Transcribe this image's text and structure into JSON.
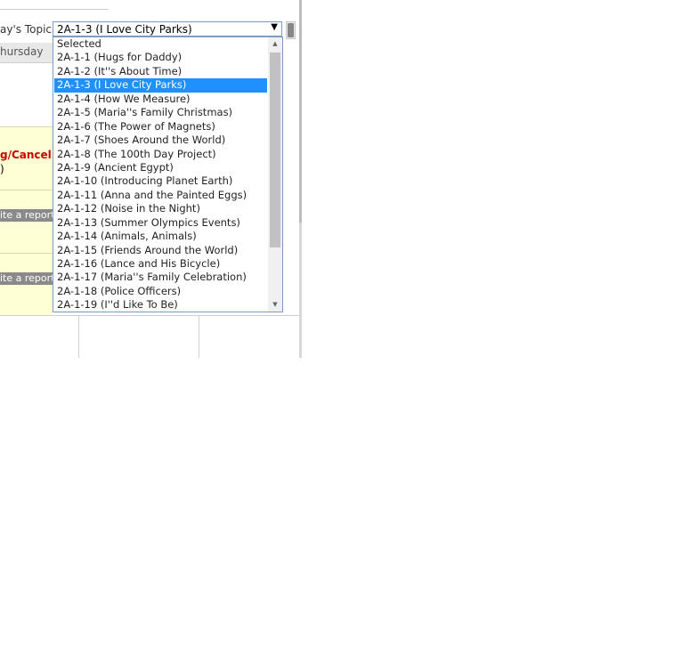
{
  "topic": {
    "label": "ay's Topic",
    "selected_value": "2A-1-3 (I Love City Parks)"
  },
  "day_header": "hursday",
  "cells": {
    "cancel_label": "g/Cancel",
    "paren_label": ")",
    "report_button_1": "ite a report",
    "report_button_2": "ite a report"
  },
  "dropdown": {
    "options": [
      "Selected",
      "2A-1-1 (Hugs for Daddy)",
      "2A-1-2 (It''s About Time)",
      "2A-1-3 (I Love City Parks)",
      "2A-1-4 (How We Measure)",
      "2A-1-5 (Maria''s Family Christmas)",
      "2A-1-6 (The Power of Magnets)",
      "2A-1-7 (Shoes Around the World)",
      "2A-1-8 (The 100th Day Project)",
      "2A-1-9 (Ancient Egypt)",
      "2A-1-10 (Introducing Planet Earth)",
      "2A-1-11 (Anna and the Painted Eggs)",
      "2A-1-12 (Noise in the Night)",
      "2A-1-13 (Summer Olympics Events)",
      "2A-1-14 (Animals, Animals)",
      "2A-1-15 (Friends Around the World)",
      "2A-1-16 (Lance and His Bicycle)",
      "2A-1-17 (Maria''s Family Celebration)",
      "2A-1-18 (Police Officers)",
      "2A-1-19 (I''d Like To Be)"
    ],
    "highlighted_index": 3
  },
  "icons": {
    "select_arrow": "chevron-down-icon",
    "scroll_up": "scroll-up-arrow-icon",
    "scroll_down": "scroll-down-arrow-icon"
  }
}
